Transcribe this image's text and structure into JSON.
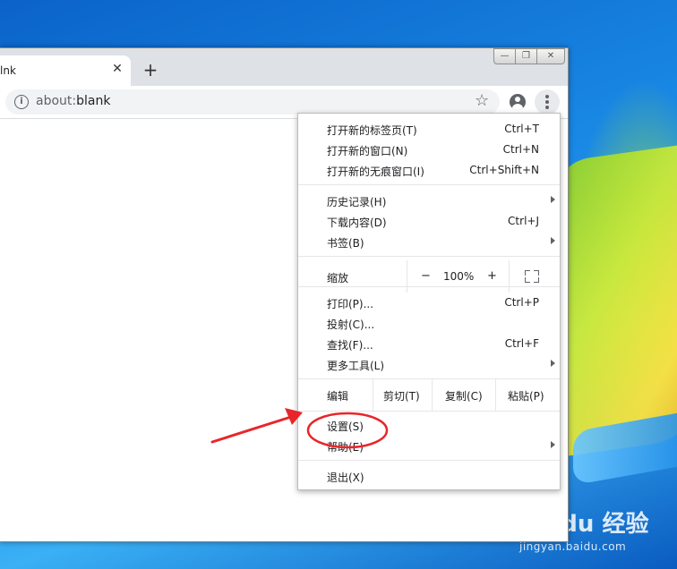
{
  "tab": {
    "title": "lnk",
    "close": "✕"
  },
  "new_tab": "+",
  "window_controls": {
    "minimize": "—",
    "restore": "❐",
    "close": "✕"
  },
  "omnibox": {
    "url_host": "about:",
    "url_path": "blank"
  },
  "menu": {
    "group1": [
      {
        "label": "打开新的标签页(T)",
        "shortcut": "Ctrl+T"
      },
      {
        "label": "打开新的窗口(N)",
        "shortcut": "Ctrl+N"
      },
      {
        "label": "打开新的无痕窗口(I)",
        "shortcut": "Ctrl+Shift+N"
      }
    ],
    "group2": [
      {
        "label": "历史记录(H)",
        "shortcut": "",
        "submenu": true
      },
      {
        "label": "下载内容(D)",
        "shortcut": "Ctrl+J"
      },
      {
        "label": "书签(B)",
        "shortcut": "",
        "submenu": true
      }
    ],
    "zoom": {
      "label": "缩放",
      "minus": "−",
      "value": "100%",
      "plus": "+"
    },
    "group3": [
      {
        "label": "打印(P)...",
        "shortcut": "Ctrl+P"
      },
      {
        "label": "投射(C)...",
        "shortcut": ""
      },
      {
        "label": "查找(F)...",
        "shortcut": "Ctrl+F"
      },
      {
        "label": "更多工具(L)",
        "shortcut": "",
        "submenu": true
      }
    ],
    "edit": {
      "label": "编辑",
      "cut": "剪切(T)",
      "copy": "复制(C)",
      "paste": "粘贴(P)"
    },
    "group4": [
      {
        "label": "设置(S)"
      },
      {
        "label": "帮助(E)",
        "submenu": true
      }
    ],
    "exit": "退出(X)"
  },
  "watermark": {
    "main": "Baidu 经验",
    "sub": "jingyan.baidu.com"
  },
  "colors": {
    "annotation": "#e8262a",
    "menu_text": "#202124",
    "desktop_blue": "#1a7fd6"
  }
}
